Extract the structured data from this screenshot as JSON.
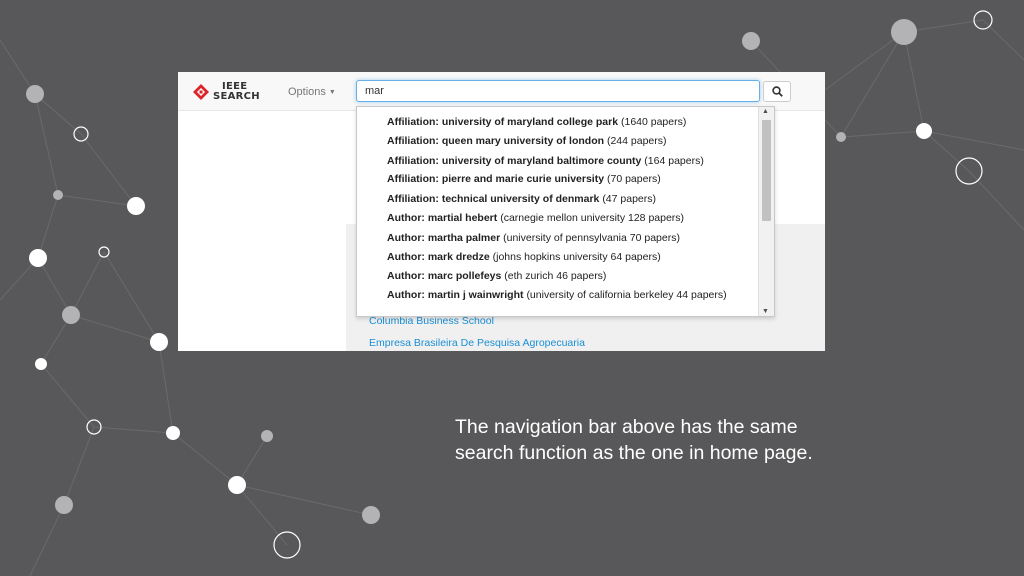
{
  "colors": {
    "background": "#58585a",
    "accent_link": "#1a8fd6",
    "input_focus": "#66afe9"
  },
  "navbar": {
    "logo_line1": "IEEE",
    "logo_line2": "SEARCH",
    "options_label": "Options",
    "search": {
      "value": "mar",
      "placeholder": ""
    },
    "search_button_icon": "search-icon"
  },
  "autocomplete": [
    {
      "kind": "Affiliation:",
      "name": "university of maryland college park",
      "detail": "(1640 papers)"
    },
    {
      "kind": "Affiliation:",
      "name": "queen mary university of london",
      "detail": "(244 papers)"
    },
    {
      "kind": "Affiliation:",
      "name": "university of maryland baltimore county",
      "detail": "(164 papers)"
    },
    {
      "kind": "Affiliation:",
      "name": "pierre and marie curie university",
      "detail": "(70 papers)"
    },
    {
      "kind": "Affiliation:",
      "name": "technical university of denmark",
      "detail": "(47 papers)"
    },
    {
      "kind": "Author:",
      "name": "martial hebert",
      "detail": "(carnegie mellon university 128 papers)"
    },
    {
      "kind": "Author:",
      "name": "martha palmer",
      "detail": "(university of pennsylvania 70 papers)"
    },
    {
      "kind": "Author:",
      "name": "mark dredze",
      "detail": "(johns hopkins university 64 papers)"
    },
    {
      "kind": "Author:",
      "name": "marc pollefeys",
      "detail": "(eth zurich 46 papers)"
    },
    {
      "kind": "Author:",
      "name": "martin j wainwright",
      "detail": "(university of california berkeley 44 papers)"
    }
  ],
  "results": [
    "Columbia Business School",
    "Empresa Brasileira De Pesquisa Agropecuaria"
  ],
  "caption": {
    "line1": "The navigation bar above has the same",
    "line2": "search function as the one in home page."
  }
}
